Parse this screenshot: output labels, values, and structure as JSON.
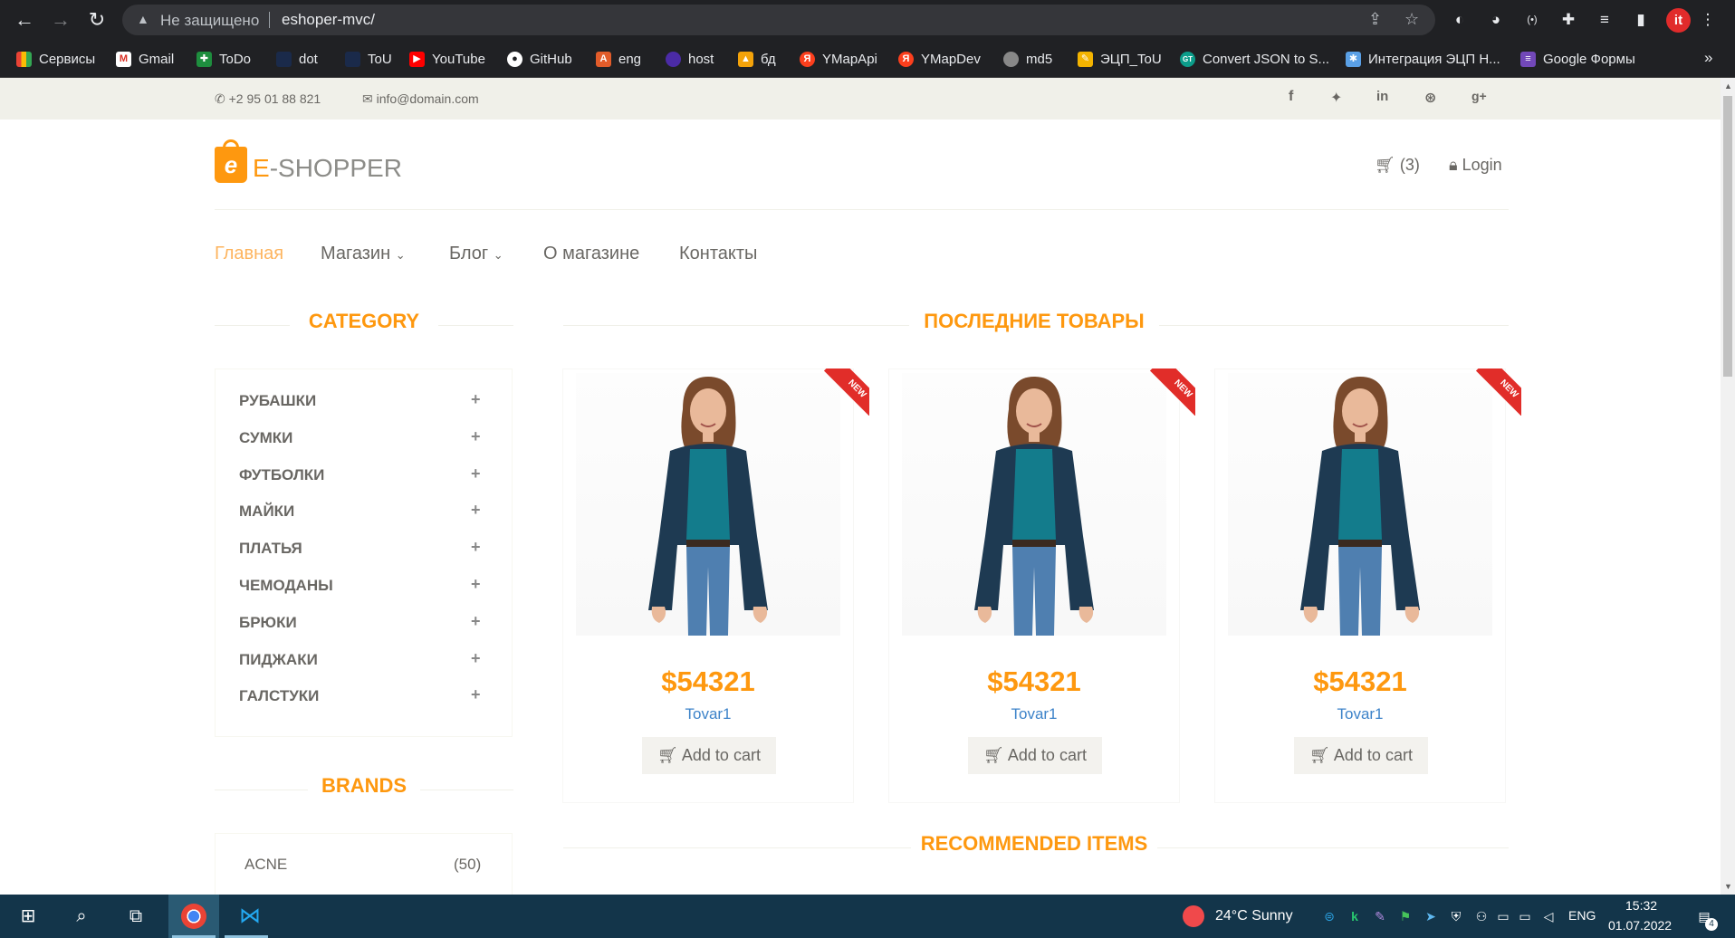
{
  "browser": {
    "security_label": "Не защищено",
    "url": "eshoper-mvc/",
    "bookmarks": [
      {
        "label": "Сервисы",
        "color": "#ea4335"
      },
      {
        "label": "Gmail",
        "color": "#d93025"
      },
      {
        "label": "ToDo",
        "color": "#1e8e3e"
      },
      {
        "label": "dot",
        "color": "#1a2a4a"
      },
      {
        "label": "ToU",
        "color": "#1a2a4a"
      },
      {
        "label": "YouTube",
        "color": "#ff0000"
      },
      {
        "label": "GitHub",
        "color": "#ffffff"
      },
      {
        "label": "eng",
        "color": "#e25c2a"
      },
      {
        "label": "host",
        "color": "#4b2ba6"
      },
      {
        "label": "бд",
        "color": "#f4a30a"
      },
      {
        "label": "YMapApi",
        "color": "#fc3f1d"
      },
      {
        "label": "YMapDev",
        "color": "#fc3f1d"
      },
      {
        "label": "md5",
        "color": "#888888"
      },
      {
        "label": "ЭЦП_ToU",
        "color": "#f4b400"
      },
      {
        "label": "Convert JSON to S...",
        "color": "#0c9d8a"
      },
      {
        "label": "Интеграция ЭЦП Н...",
        "color": "#5aa0e6"
      },
      {
        "label": "Google Формы",
        "color": "#7248b9"
      }
    ],
    "more": "»"
  },
  "site": {
    "phone": "+2 95 01 88 821",
    "email": "info@domain.com",
    "logo_e": "E",
    "logo_rest": "-SHOPPER",
    "cart_count": "(3)",
    "login": "Login",
    "nav": [
      {
        "label": "Главная",
        "active": true
      },
      {
        "label": "Магазин",
        "dropdown": true
      },
      {
        "label": "Блог",
        "dropdown": true
      },
      {
        "label": "О магазине"
      },
      {
        "label": "Контакты"
      }
    ],
    "category_title": "CATEGORY",
    "categories": [
      "РУБАШКИ",
      "СУМКИ",
      "ФУТБОЛКИ",
      "МАЙКИ",
      "ПЛАТЬЯ",
      "ЧЕМОДАНЫ",
      "БРЮКИ",
      "ПИДЖАКИ",
      "ГАЛСТУКИ"
    ],
    "brands_title": "BRANDS",
    "brands": [
      {
        "name": "ACNE",
        "count": "(50)"
      }
    ],
    "latest_title": "ПОСЛЕДНИЕ ТОВАРЫ",
    "recommended_title": "RECOMMENDED ITEMS",
    "products": [
      {
        "price": "$54321",
        "name": "Tovar1",
        "badge": "NEW",
        "cart_label": "Add to cart"
      },
      {
        "price": "$54321",
        "name": "Tovar1",
        "badge": "NEW",
        "cart_label": "Add to cart"
      },
      {
        "price": "$54321",
        "name": "Tovar1",
        "badge": "NEW",
        "cart_label": "Add to cart"
      }
    ]
  },
  "taskbar": {
    "weather": "24°C  Sunny",
    "lang": "ENG",
    "time": "15:32",
    "date": "01.07.2022",
    "notifications": "4"
  }
}
